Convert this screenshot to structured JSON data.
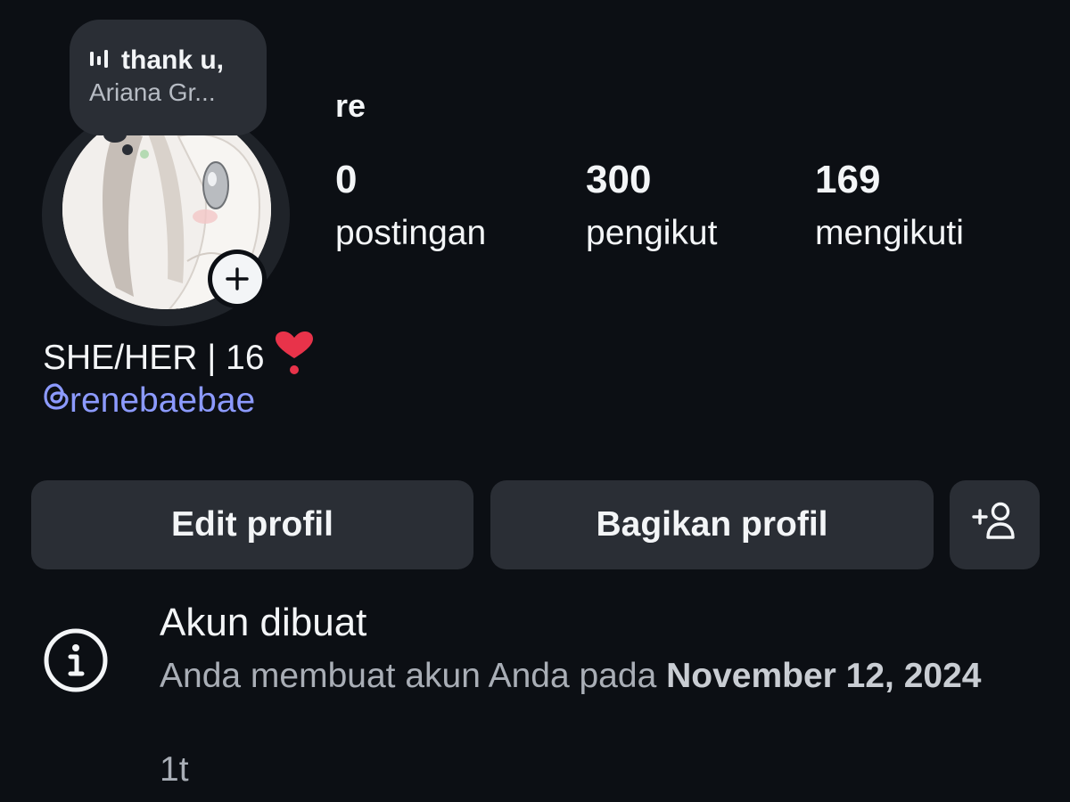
{
  "note": {
    "song": "thank u,",
    "artist": "Ariana Gr...",
    "icon": "music-bars-icon"
  },
  "profile": {
    "display_name": "re",
    "bio": "SHE/HER | 16",
    "bio_emoji": "heart-exclamation-icon",
    "threads_username": "renebaebae"
  },
  "stats": {
    "posts_count": "0",
    "posts_label": "postingan",
    "followers_count": "300",
    "followers_label": "pengikut",
    "following_count": "169",
    "following_label": "mengikuti"
  },
  "buttons": {
    "edit_label": "Edit profil",
    "share_label": "Bagikan profil",
    "add_user_icon": "add-user-icon"
  },
  "account_info": {
    "title": "Akun dibuat",
    "description_prefix": "Anda membuat akun Anda pada ",
    "date": "November 12, 2024",
    "time_ago": "1t"
  },
  "colors": {
    "background": "#0c0f14",
    "surface": "#2a2e35",
    "text": "#f3f5f7",
    "muted": "#a9aeb6",
    "link": "#8c9aff",
    "heart": "#e8334a"
  }
}
